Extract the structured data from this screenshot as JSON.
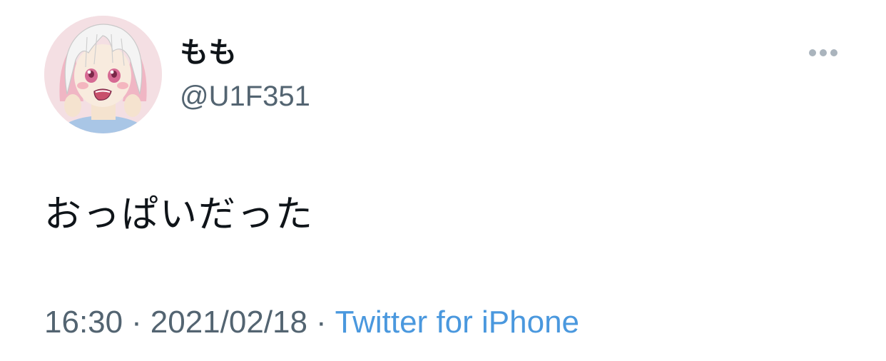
{
  "user": {
    "display_name": "もも",
    "handle": "@U1F351",
    "avatar_icon": "anime-girl-avatar"
  },
  "tweet": {
    "text": "おっぱいだった"
  },
  "meta": {
    "time": "16:30",
    "separator": "·",
    "date": "2021/02/18",
    "source": "Twitter for iPhone"
  },
  "more_icon": "more-horizontal-icon",
  "colors": {
    "text_primary": "#0f1419",
    "text_secondary": "#536471",
    "link": "#4a98de",
    "icon_gray": "#aab4bd"
  }
}
